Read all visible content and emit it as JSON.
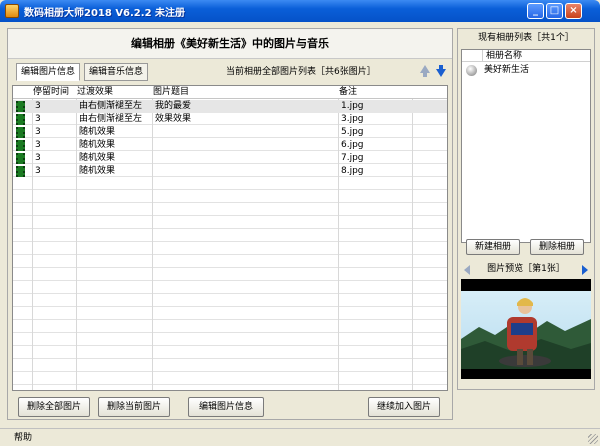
{
  "window": {
    "title": "数码相册大师2018 V6.2.2  未注册",
    "minimize": "_",
    "maximize": "□",
    "close": "×"
  },
  "main": {
    "heading": "编辑相册《美好新生活》中的图片与音乐",
    "tabs": [
      {
        "label": "编辑图片信息",
        "active": true
      },
      {
        "label": "编辑音乐信息",
        "active": false
      }
    ],
    "list_title": "当前相册全部图片列表［共6张图片］",
    "columns": [
      "停留时间",
      "过渡效果",
      "图片题目",
      "备注"
    ],
    "rows": [
      {
        "icon": "film-icon",
        "duration": "3",
        "transition": "由右侧渐褪至左",
        "title": "我的最爱",
        "note": "1.jpg"
      },
      {
        "icon": "film-icon",
        "duration": "3",
        "transition": "由右侧渐褪至左",
        "title": "效果效果",
        "note": "3.jpg"
      },
      {
        "icon": "film-icon",
        "duration": "3",
        "transition": "随机效果",
        "title": "",
        "note": "5.jpg"
      },
      {
        "icon": "film-icon",
        "duration": "3",
        "transition": "随机效果",
        "title": "",
        "note": "6.jpg"
      },
      {
        "icon": "film-icon",
        "duration": "3",
        "transition": "随机效果",
        "title": "",
        "note": "7.jpg"
      },
      {
        "icon": "film-icon",
        "duration": "3",
        "transition": "随机效果",
        "title": "",
        "note": "8.jpg"
      }
    ],
    "buttons": {
      "delete_all": "删除全部图片",
      "delete_current": "删除当前图片",
      "edit_info": "编辑图片信息",
      "continue_add": "继续加入图片"
    }
  },
  "sidebar": {
    "album_list_title": "现有相册列表［共1个］",
    "album_column": "相册名称",
    "albums": [
      {
        "name": "美好新生活",
        "icon": "album-icon"
      }
    ],
    "buttons": {
      "new_album": "新建相册",
      "delete_album": "删除相册"
    },
    "preview_title": "图片预览［第1张］"
  },
  "statusbar": {
    "text": "帮助"
  },
  "colors": {
    "titlebar": "#0A5FD8",
    "window_bg": "#ECE9D8",
    "arrow_active": "#1a5fd0",
    "arrow_inactive": "#9aa9c2",
    "icon_green": "#1b7a22"
  }
}
